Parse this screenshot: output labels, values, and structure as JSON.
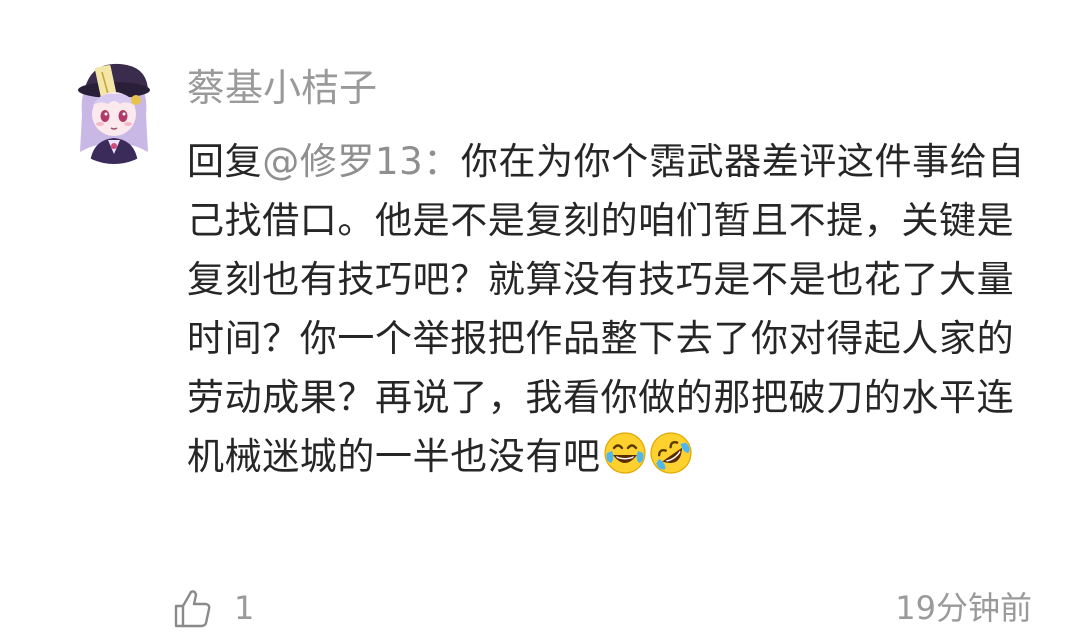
{
  "comment": {
    "username": "蔡基小桔子",
    "reply_prefix": "回复",
    "mention": "@修罗13",
    "separator": "：",
    "text": "你在为你个霑武器差评这件事给自己找借口。他是不是复刻的咱们暂且不提，关键是复刻也有技巧吧？就算没有技巧是不是也花了大量时间？你一个举报把作品整下去了你对得起人家的劳动成果？再说了，我看你做的那把破刀的水平连机械迷城的一半也没有吧",
    "emojis": [
      "tears-of-joy-emoji",
      "rolling-on-floor-laughing-emoji"
    ],
    "like_count": "1",
    "timestamp": "19分钟前"
  },
  "colors": {
    "username": "#9a9a9a",
    "text": "#262626",
    "mention": "#8f8f8f",
    "meta": "#9a9a9a",
    "background": "#ffffff"
  },
  "icons": {
    "avatar": "anime-character-avatar",
    "like": "thumbs-up-icon"
  }
}
